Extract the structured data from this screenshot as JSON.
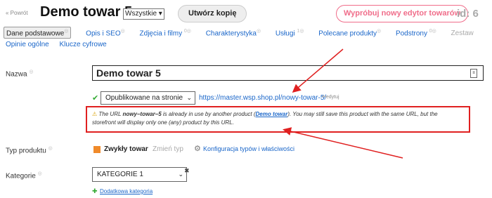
{
  "header": {
    "back_label": "« Powrót",
    "title": "Demo towar 5",
    "lang_select": "Wszystkie",
    "copy_label": "Utwórz kopię",
    "try_label": "Wypróbuj nowy edytor towarów",
    "id_label": "id: 6"
  },
  "tabs": [
    {
      "label": "Dane podstawowe",
      "count": ""
    },
    {
      "label": "Opis i SEO",
      "count": ""
    },
    {
      "label": "Zdjęcia i filmy",
      "count": "0"
    },
    {
      "label": "Charakterystyka",
      "count": ""
    },
    {
      "label": "Usługi",
      "count": "1"
    },
    {
      "label": "Polecane produkty",
      "count": ""
    },
    {
      "label": "Podstrony",
      "count": "0"
    },
    {
      "label": "Zestaw",
      "count": ""
    }
  ],
  "tabs_row2": [
    "Opinie ogólne",
    "Klucze cyfrowe"
  ],
  "form": {
    "name_label": "Nazwa",
    "name_value": "Demo towar 5",
    "status_value": "Opublikowane na stronie",
    "url": "https://master.wsp.shop.pl/nowy-towar-5/",
    "edit_label": "edytuj",
    "warning": {
      "icon": "warning-icon",
      "before": "The URL",
      "slug": "nowy–towar–5",
      "middle": "is already in use by another product (",
      "product_link": "Demo towar",
      "after": "). You may still save this product with the same URL, but the storefront will display only one (any) product by this URL."
    },
    "type_label": "Typ produktu",
    "type_value": "Zwykły towar",
    "change_type": "Zmień typ",
    "config_link": "Konfiguracja typów i właściwości",
    "category_label": "Kategorie",
    "category_value": "KATEGORIE 1",
    "add_category": "Dodatkowa kategoria"
  },
  "colors": {
    "accent": "#1a66c9",
    "danger": "#e02020",
    "pink": "#f06d8a"
  }
}
